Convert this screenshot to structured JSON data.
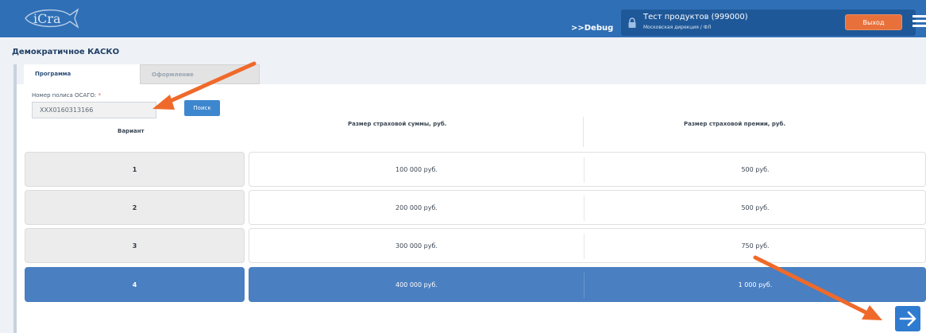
{
  "header": {
    "logo_text": "iCra",
    "debug_link": ">>Debug",
    "user_name": "Тест продуктов (999000)",
    "user_subtitle": "Московская дирекция / ФЛ",
    "logout_label": "Выход"
  },
  "page": {
    "title": "Демократичное КАСКО",
    "tabs": [
      {
        "label": "Программа",
        "active": true
      },
      {
        "label": "Оформление",
        "active": false
      }
    ]
  },
  "form": {
    "policy_label": "Номер полиса ОСАГО:",
    "required_mark": "*",
    "policy_value": "XXX0160313166",
    "search_label": "Поиск"
  },
  "table": {
    "headers": {
      "variant": "Вариант",
      "sum": "Размер страховой суммы, руб.",
      "premium": "Размер страховой премии, руб."
    },
    "rows": [
      {
        "variant": "1",
        "sum": "100 000 руб.",
        "premium": "500 руб.",
        "selected": false
      },
      {
        "variant": "2",
        "sum": "200 000 руб.",
        "premium": "500 руб.",
        "selected": false
      },
      {
        "variant": "3",
        "sum": "300 000 руб.",
        "premium": "750 руб.",
        "selected": false
      },
      {
        "variant": "4",
        "sum": "400 000 руб.",
        "premium": "1 000 руб.",
        "selected": true
      }
    ]
  },
  "icons": {
    "lock": "lock-icon",
    "menu": "hamburger-menu-icon",
    "next": "arrow-right-icon"
  },
  "colors": {
    "header": "#2f6fb6",
    "selected_row": "#4a7fc1",
    "logout": "#e8703a",
    "annotation_arrow": "#ef6a2a"
  }
}
